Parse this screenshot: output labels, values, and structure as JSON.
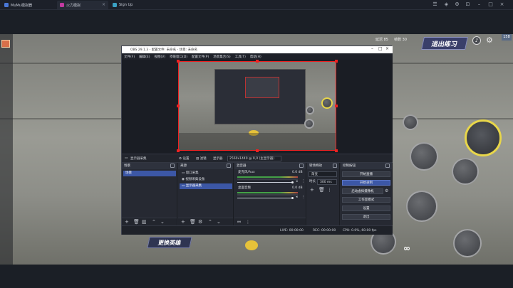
{
  "browser": {
    "tabs": [
      {
        "label": "MuMu模拟器",
        "icon_color": "#4a78d8"
      },
      {
        "label": "火力模拟",
        "icon_color": "#c23aa0"
      },
      {
        "label": "Sign Up",
        "icon_color": "#3aa0c2"
      }
    ]
  },
  "game": {
    "exit_label": "退出练习",
    "swap_label": "更换英雄",
    "latency": "158",
    "stat_a": "延迟 85",
    "stat_b": "帧数 30",
    "avatar_color": "#d8704a",
    "ult_color": "#e8d64a",
    "infinity": "∞"
  },
  "obs": {
    "title": "OBS 29.1.3 - 配置文件: 未命名 - 场景: 未命名",
    "menu": [
      "文件(F)",
      "编辑(E)",
      "视图(V)",
      "停靠窗口(D)",
      "配置文件(P)",
      "场景集合(S)",
      "工具(T)",
      "帮助(H)"
    ],
    "toolbar": {
      "source_label": "显示器采集",
      "settings": "设置",
      "filters": "滤镜",
      "display": "显示器",
      "display_value": "2560x1440 @ 0,0 (主显示器)"
    },
    "scenes": {
      "title": "场景",
      "items": [
        "场景"
      ]
    },
    "sources": {
      "title": "来源",
      "items": [
        "窗口采集",
        "视频采集设备",
        "显示器采集"
      ]
    },
    "mixer": {
      "title": "混音器",
      "channels": [
        {
          "name": "麦克风/Aux",
          "db": "0.0 dB"
        },
        {
          "name": "桌面音频",
          "db": "0.0 dB"
        }
      ]
    },
    "transitions": {
      "title": "转场特效",
      "type": "渐变",
      "duration_label": "时长",
      "duration_value": "300 ms"
    },
    "controls": {
      "title": "控制按钮",
      "buttons": [
        "开始直播",
        "开始录制",
        "启动虚拟摄像机",
        "工作室模式",
        "设置",
        "退出"
      ]
    },
    "status": {
      "live": "LIVE: 00:00:00",
      "rec": "REC: 00:00:00",
      "cpu": "CPU: 0.0%, 60.00 fps"
    }
  }
}
